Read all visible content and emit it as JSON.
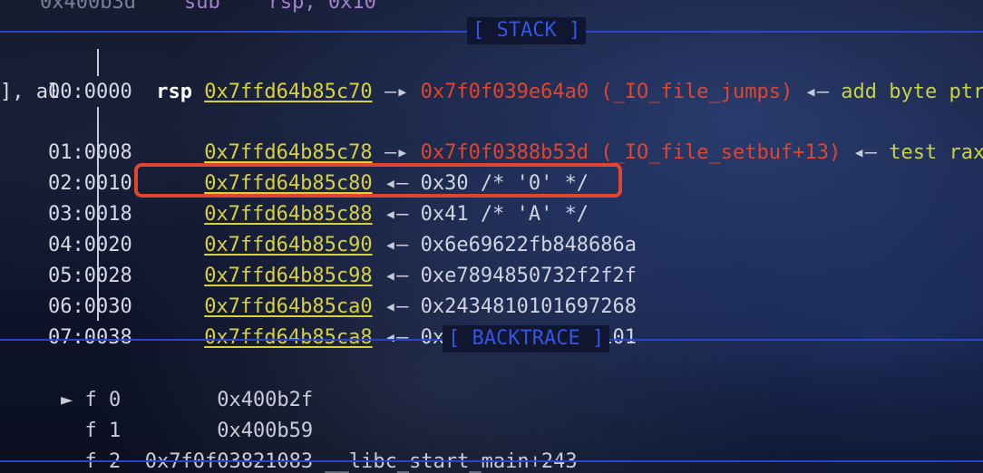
{
  "top_line": {
    "addr": "0x400b3d",
    "mnemonic": "sub",
    "operands": "rsp, 0x10"
  },
  "stack_header": "[ STACK ]",
  "backtrace_header": "[ BACKTRACE ]",
  "stack": [
    {
      "offset": "00:0000",
      "reg": "rsp",
      "addr": "0x7ffd64b85c70",
      "arrow": "—▸",
      "ptr": "0x7f0f039e64a0 (_IO_file_jumps)",
      "arrow2": "◂—",
      "instr": "add byte ptr",
      "cont": "], al"
    },
    {
      "offset": "01:0008",
      "reg": "",
      "addr": "0x7ffd64b85c78",
      "arrow": "—▸",
      "ptr": "0x7f0f0388b53d (_IO_file_setbuf+13)",
      "arrow2": "◂—",
      "instr": "test rax"
    },
    {
      "offset": "02:0010",
      "reg": "",
      "addr": "0x7ffd64b85c80",
      "arrow": "◂—",
      "value": "0x30 /* '0' */"
    },
    {
      "offset": "03:0018",
      "reg": "",
      "addr": "0x7ffd64b85c88",
      "arrow": "◂—",
      "value": "0x41 /* 'A' */"
    },
    {
      "offset": "04:0020",
      "reg": "",
      "addr": "0x7ffd64b85c90",
      "arrow": "◂—",
      "value": "0x6e69622fb848686a"
    },
    {
      "offset": "05:0028",
      "reg": "",
      "addr": "0x7ffd64b85c98",
      "arrow": "◂—",
      "value": "0xe7894850732f2f2f"
    },
    {
      "offset": "06:0030",
      "reg": "",
      "addr": "0x7ffd64b85ca0",
      "arrow": "◂—",
      "value": "0x2434810101697268"
    },
    {
      "offset": "07:0038",
      "reg": "",
      "addr": "0x7ffd64b85ca8",
      "arrow": "◂—",
      "value": "0x6a56f63101010101"
    }
  ],
  "backtrace": [
    {
      "marker": "►",
      "frame": "f 0",
      "addr": "0x400b2f",
      "sym": ""
    },
    {
      "marker": "",
      "frame": "f 1",
      "addr": "0x400b59",
      "sym": ""
    },
    {
      "marker": "",
      "frame": "f 2",
      "addr": "0x7f0f03821083",
      "sym": "__libc_start_main+243"
    }
  ]
}
